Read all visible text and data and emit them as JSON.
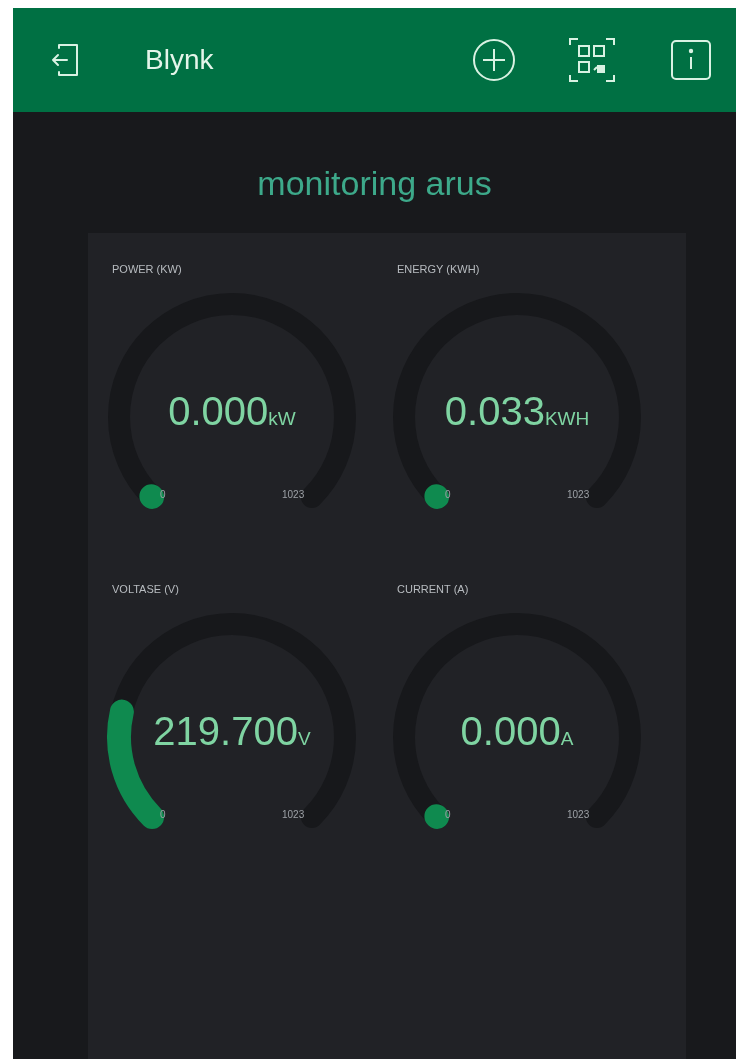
{
  "header": {
    "title": "Blynk"
  },
  "dashboard": {
    "title": "monitoring arus"
  },
  "gauges": [
    {
      "label": "POWER (KW)",
      "value": "0.000",
      "unit": "kW",
      "min": "0",
      "max": "1023"
    },
    {
      "label": "ENERGY (KWH)",
      "value": "0.033",
      "unit": "KWH",
      "min": "0",
      "max": "1023"
    },
    {
      "label": "VOLTASE (V)",
      "value": "219.700",
      "unit": "V",
      "min": "0",
      "max": "1023"
    },
    {
      "label": "CURRENT (A)",
      "value": "0.000",
      "unit": "A",
      "min": "0",
      "max": "1023"
    }
  ]
}
